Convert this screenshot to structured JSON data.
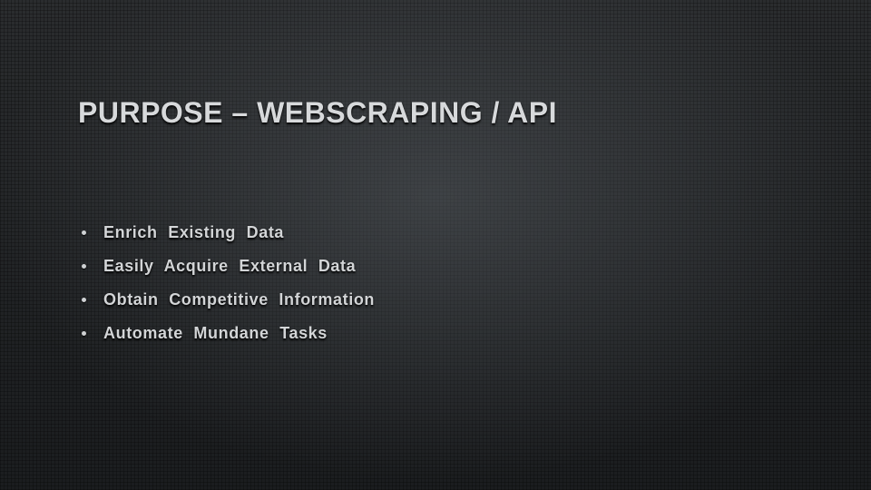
{
  "slide": {
    "title": "PURPOSE – WEBSCRAPING / API",
    "bullets": [
      "Enrich  Existing  Data",
      "Easily  Acquire  External   Data",
      "Obtain  Competitive  Information",
      "Automate  Mundane Tasks"
    ]
  }
}
